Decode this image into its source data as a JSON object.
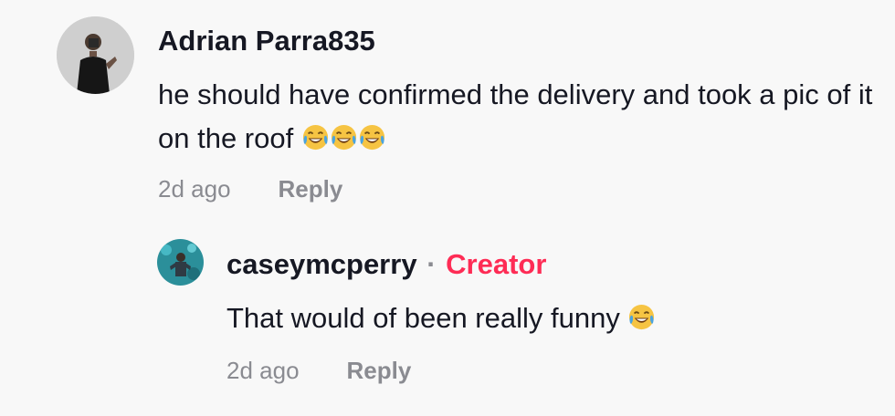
{
  "comment": {
    "username": "Adrian Parra835",
    "text": "he should have confirmed the delivery and took a pic of it on the roof",
    "emoji_icon": "face-with-tears-of-joy-icon",
    "time": "2d ago",
    "reply_label": "Reply"
  },
  "reply": {
    "username": "caseymcperry",
    "separator": "·",
    "badge": "Creator",
    "text": "That would of been really funny",
    "emoji_icon": "face-with-tears-of-joy-icon",
    "time": "2d ago",
    "reply_label": "Reply"
  },
  "colors": {
    "background": "#f8f8f8",
    "text": "#161823",
    "muted": "#8a8b91",
    "creator": "#fe2c55"
  }
}
